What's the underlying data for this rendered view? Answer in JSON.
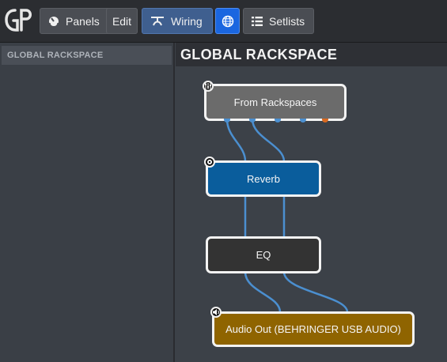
{
  "toolbar": {
    "panels_label": "Panels",
    "edit_label": "Edit",
    "wiring_label": "Wiring",
    "setlists_label": "Setlists"
  },
  "sidebar": {
    "header": "GLOBAL RACKSPACE"
  },
  "main": {
    "title": "GLOBAL RACKSPACE"
  },
  "blocks": {
    "from_rackspaces": {
      "label": "From Rackspaces",
      "color": "#6b6b6b"
    },
    "reverb": {
      "label": "Reverb",
      "color": "#0a5d9c"
    },
    "eq": {
      "label": "EQ",
      "color": "#333333"
    },
    "audio_out": {
      "label": "Audio Out (BEHRINGER USB AUDIO)",
      "color": "#8f6400"
    }
  },
  "colors": {
    "wire": "#4b8fd0",
    "midi_pin": "#d9691f",
    "accent_blue": "#1a66e0"
  }
}
